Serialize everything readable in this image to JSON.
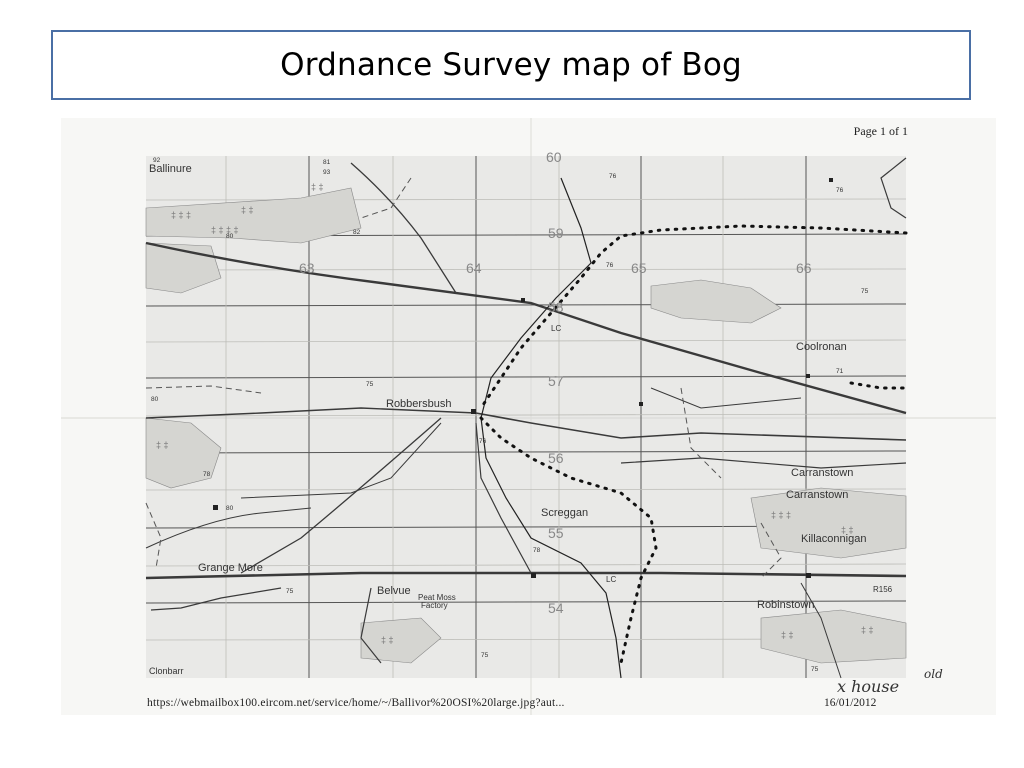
{
  "slide": {
    "title": "Ordnance Survey map of Bog"
  },
  "scan": {
    "page_indicator": "Page 1 of 1",
    "footer_url": "https://webmailbox100.eircom.net/service/home/~/Ballivor%20OSI%20large.jpg?aut...",
    "footer_date": "16/01/2012",
    "handwritten_note_line1": "old",
    "handwritten_note_line2": "x house"
  },
  "map": {
    "place_names": {
      "ballinure": "Ballinure",
      "coolronan": "Coolronan",
      "robbersbush": "Robbersbush",
      "carranstown_1": "Carranstown",
      "carranstown_2": "Carranstown",
      "screggan": "Screggan",
      "killaconnigan": "Killaconnigan",
      "grange_more": "Grange More",
      "belvue": "Belvue",
      "peat_moss_1": "Peat Moss",
      "peat_moss_2": "Factory",
      "robinstown": "Robinstown",
      "clonbarr": "Clonbarr",
      "lc_1": "LC",
      "lc_2": "LC",
      "road_r156": "R156"
    },
    "easting_labels": [
      "63",
      "64",
      "65",
      "66"
    ],
    "northing_labels": [
      "60",
      "59",
      "58",
      "57",
      "56",
      "55",
      "54"
    ],
    "spot_heights": [
      "92",
      "81",
      "93",
      "76",
      "82",
      "80",
      "76",
      "76",
      "75",
      "71",
      "75",
      "76",
      "80",
      "78",
      "80",
      "78",
      "75",
      "75",
      "75"
    ]
  }
}
